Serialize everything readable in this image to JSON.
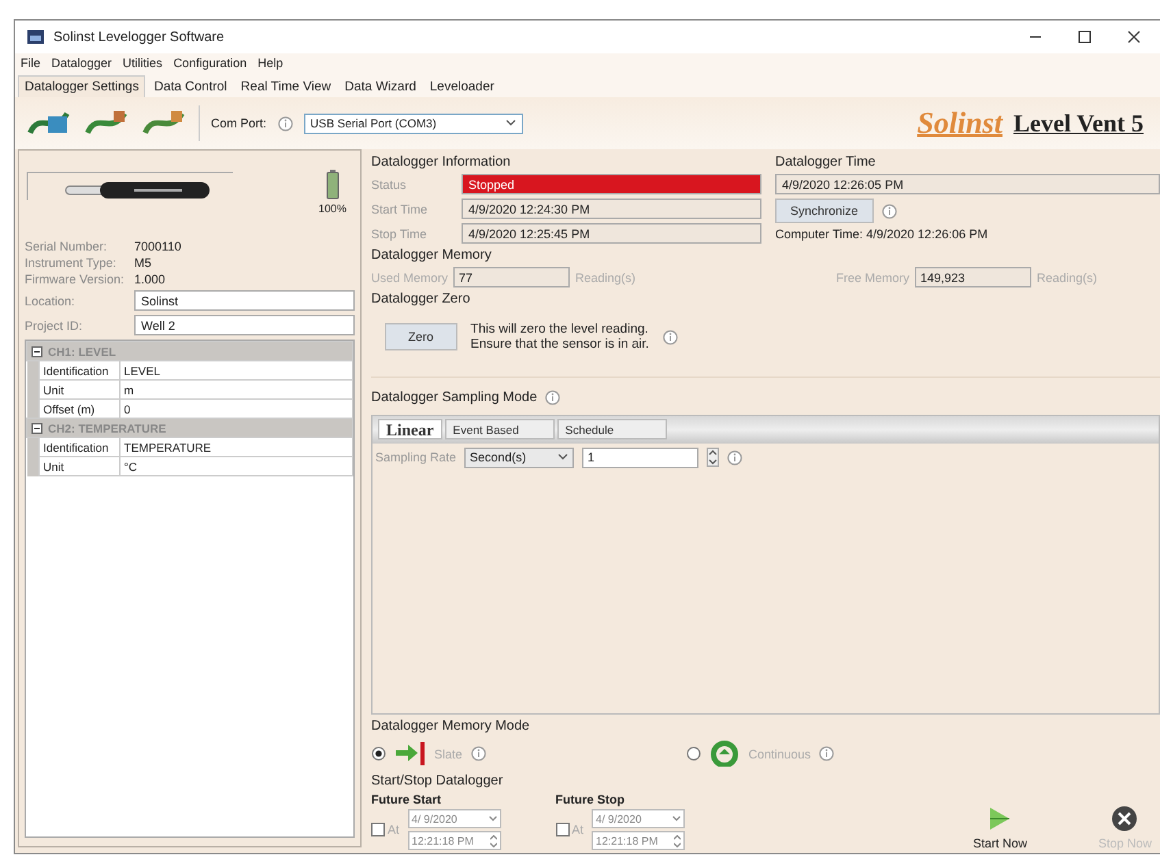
{
  "window": {
    "title": "Solinst Levelogger Software"
  },
  "menu": [
    "File",
    "Datalogger",
    "Utilities",
    "Configuration",
    "Help"
  ],
  "tabs": [
    {
      "label": "Datalogger Settings",
      "selected": true
    },
    {
      "label": "Data Control",
      "selected": false
    },
    {
      "label": "Real Time View",
      "selected": false
    },
    {
      "label": "Data Wizard",
      "selected": false
    },
    {
      "label": "Leveloader",
      "selected": false
    }
  ],
  "toolbar": {
    "com_port_label": "Com Port:",
    "com_port": "USB Serial Port (COM3)",
    "logo_brand": "Solinst",
    "logo_product": "Level Vent 5"
  },
  "device": {
    "battery": "100%",
    "info": [
      {
        "label": "Serial Number:",
        "value": "7000110"
      },
      {
        "label": "Instrument Type:",
        "value": "M5"
      },
      {
        "label": "Firmware Version:",
        "value": "1.000"
      }
    ],
    "fields": [
      {
        "label": "Location:",
        "value": "Solinst"
      },
      {
        "label": "Project ID:",
        "value": "Well 2"
      }
    ]
  },
  "channels": [
    {
      "header": "CH1: LEVEL",
      "expanded": true,
      "rows": [
        {
          "name": "Identification",
          "value": "LEVEL"
        },
        {
          "name": "Unit",
          "value": "m"
        },
        {
          "name": "Offset (m)",
          "value": "0"
        }
      ]
    },
    {
      "header": "CH2: TEMPERATURE",
      "expanded": true,
      "rows": [
        {
          "name": "Identification",
          "value": "TEMPERATURE"
        },
        {
          "name": "Unit",
          "value": "°C"
        }
      ]
    }
  ],
  "information": {
    "title": "Datalogger Information",
    "status_label": "Status",
    "status": {
      "text": "Stopped",
      "kind": "stopped"
    },
    "rows": [
      {
        "label": "Start Time",
        "value": "4/9/2020 12:24:30 PM"
      },
      {
        "label": "Stop Time",
        "value": "4/9/2020 12:25:45 PM"
      }
    ]
  },
  "time": {
    "title": "Datalogger Time",
    "value": "4/9/2020 12:26:05 PM",
    "button": "Synchronize",
    "computer_time": "Computer Time: 4/9/2020 12:26:06 PM"
  },
  "memory": {
    "title": "Datalogger Memory",
    "used_label": "Used Memory",
    "used": "77",
    "used_unit": "Reading(s)",
    "free_label": "Free Memory",
    "free": "149,923",
    "free_unit": "Reading(s)"
  },
  "zero": {
    "title": "Datalogger Zero",
    "button": "Zero",
    "text": "This will zero the level reading.\nEnsure that the sensor is in air."
  },
  "sampling": {
    "title": "Datalogger Sampling Mode",
    "tabs": [
      {
        "label": "Linear",
        "selected": true
      },
      {
        "label": "Event Based",
        "selected": false
      },
      {
        "label": "Schedule",
        "selected": false
      }
    ],
    "rate_label": "Sampling Rate",
    "unit": "Second(s)",
    "value": "1"
  },
  "memory_mode": {
    "title": "Datalogger Memory Mode",
    "options": [
      {
        "label": "Slate",
        "kind": "slate",
        "selected": true
      },
      {
        "label": "Continuous",
        "kind": "continuous",
        "selected": false
      }
    ]
  },
  "start_stop": {
    "title": "Start/Stop Datalogger",
    "schedules": [
      {
        "title": "Future Start",
        "checkbox": "At",
        "checked": false,
        "date": "4/ 9/2020",
        "time": "12:21:18 PM"
      },
      {
        "title": "Future Stop",
        "checkbox": "At",
        "checked": false,
        "date": "4/ 9/2020",
        "time": "12:21:18 PM"
      }
    ],
    "buttons": [
      {
        "label": "Start Now",
        "kind": "start",
        "disabled": false
      },
      {
        "label": "Stop Now",
        "kind": "stop",
        "disabled": true
      }
    ]
  }
}
